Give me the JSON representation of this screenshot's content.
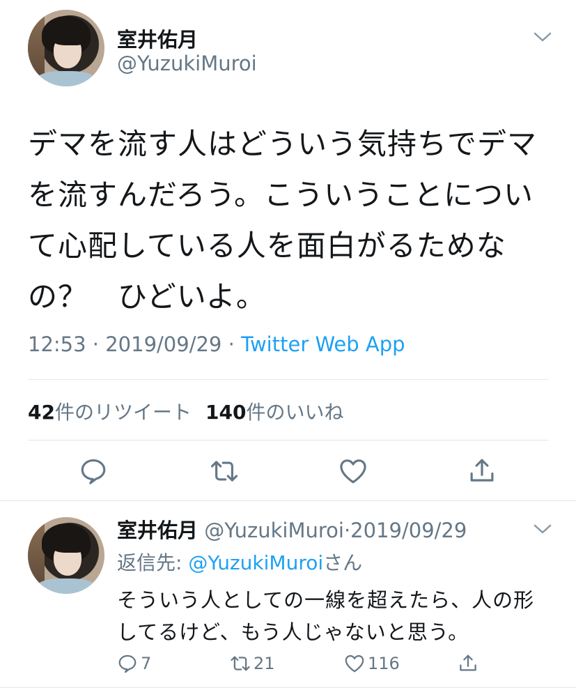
{
  "tweet": {
    "display_name": "室井佑月",
    "handle": "@YuzukiMuroi",
    "text_lines": [
      "デマを流す人はどういう気持ちでデマ",
      "を流すんだろう。こういうことについ",
      "て心配している人を面白がるためな",
      "の？　ひどいよ。"
    ],
    "time": "12:53",
    "date": "2019/09/29",
    "separator": " · ",
    "source": "Twitter Web App",
    "retweet_count": "42",
    "retweet_label": "件のリツイート",
    "like_count": "140",
    "like_label": "件のいいね",
    "actions": [
      "reply-icon",
      "retweet-icon",
      "like-icon",
      "share-icon"
    ]
  },
  "reply": {
    "display_name": "室井佑月",
    "handle": "@YuzukiMuroi",
    "date": "2019/09/29",
    "dot": "·",
    "reply_to_label": "返信先: ",
    "reply_to_mention": "@YuzukiMuroi",
    "reply_to_suffix": "さん",
    "text_lines": [
      "そういう人としての一線を超えたら、人の形",
      "してるけど、もう人じゃないと思う。"
    ],
    "reply_count": "7",
    "retweet_count": "21",
    "like_count": "116"
  },
  "colors": {
    "text": "#14171a",
    "secondary": "#657786",
    "link": "#1da1f2",
    "divider": "#e1e8ed"
  }
}
